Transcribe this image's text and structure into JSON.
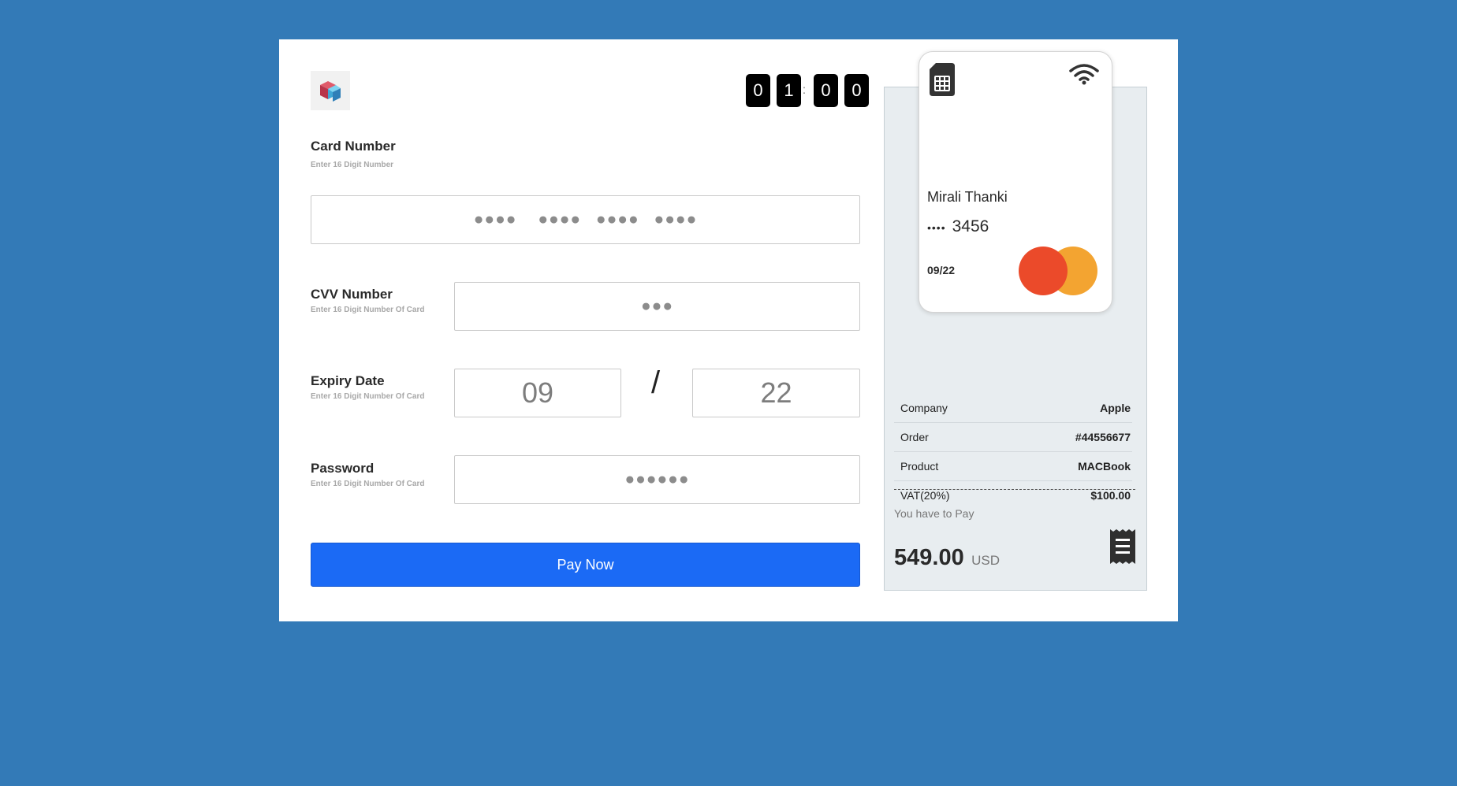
{
  "timer": {
    "d1": "0",
    "d2": "1",
    "colon": ":",
    "d3": "0",
    "d4": "0"
  },
  "form": {
    "card_number": {
      "label": "Card Number",
      "hint": "Enter 16 Digit Number",
      "groups": [
        "●●●●",
        "●●●●",
        "●●●●",
        "●●●●"
      ]
    },
    "cvv": {
      "label": "CVV Number",
      "hint": "Enter 16 Digit Number Of Card",
      "value": "●●●"
    },
    "expiry": {
      "label": "Expiry Date",
      "hint": "Enter 16 Digit Number Of Card",
      "month": "09",
      "separator": "/",
      "year": "22"
    },
    "password": {
      "label": "Password",
      "hint": "Enter 16 Digit Number Of Card",
      "value": "●●●●●●"
    },
    "pay_button": "Pay Now"
  },
  "card": {
    "holder": "Mirali Thanki",
    "mask": "••••",
    "last4": "3456",
    "expiry": "09/22"
  },
  "summary": {
    "rows": [
      {
        "key": "Company",
        "value": "Apple"
      },
      {
        "key": "Order",
        "value": "#44556677"
      },
      {
        "key": "Product",
        "value": "MACBook"
      },
      {
        "key": "VAT(20%)",
        "value": "$100.00"
      }
    ],
    "you_have_to_pay": "You have to Pay",
    "amount": "549.00",
    "currency": "USD"
  },
  "colors": {
    "background": "#337ab7",
    "button": "#1b6af5",
    "mc_red": "#eb4a2a",
    "mc_yellow": "#f29c1f"
  }
}
